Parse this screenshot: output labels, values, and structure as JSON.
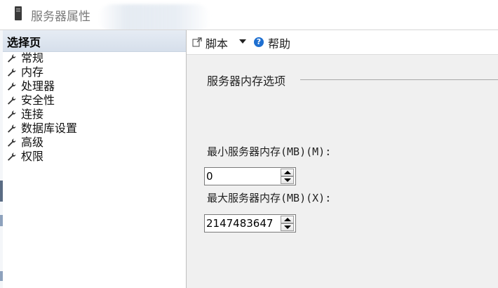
{
  "window": {
    "title": "服务器属性"
  },
  "left_pane": {
    "header": "选择页",
    "items": [
      {
        "label": "常规"
      },
      {
        "label": "内存"
      },
      {
        "label": "处理器"
      },
      {
        "label": "安全性"
      },
      {
        "label": "连接"
      },
      {
        "label": "数据库设置"
      },
      {
        "label": "高级"
      },
      {
        "label": "权限"
      }
    ]
  },
  "toolbar": {
    "script_label": "脚本",
    "help_label": "帮助"
  },
  "memory": {
    "group_title": "服务器内存选项",
    "min_label": "最小服务器内存(MB)(M):",
    "min_value": "0",
    "max_label": "最大服务器内存(MB)(X):",
    "max_value": "2147483647"
  },
  "colors": {
    "help_icon": "#1e6fd0",
    "header_bg": "#dbe3ee",
    "right_bg": "#f0f0f0"
  }
}
